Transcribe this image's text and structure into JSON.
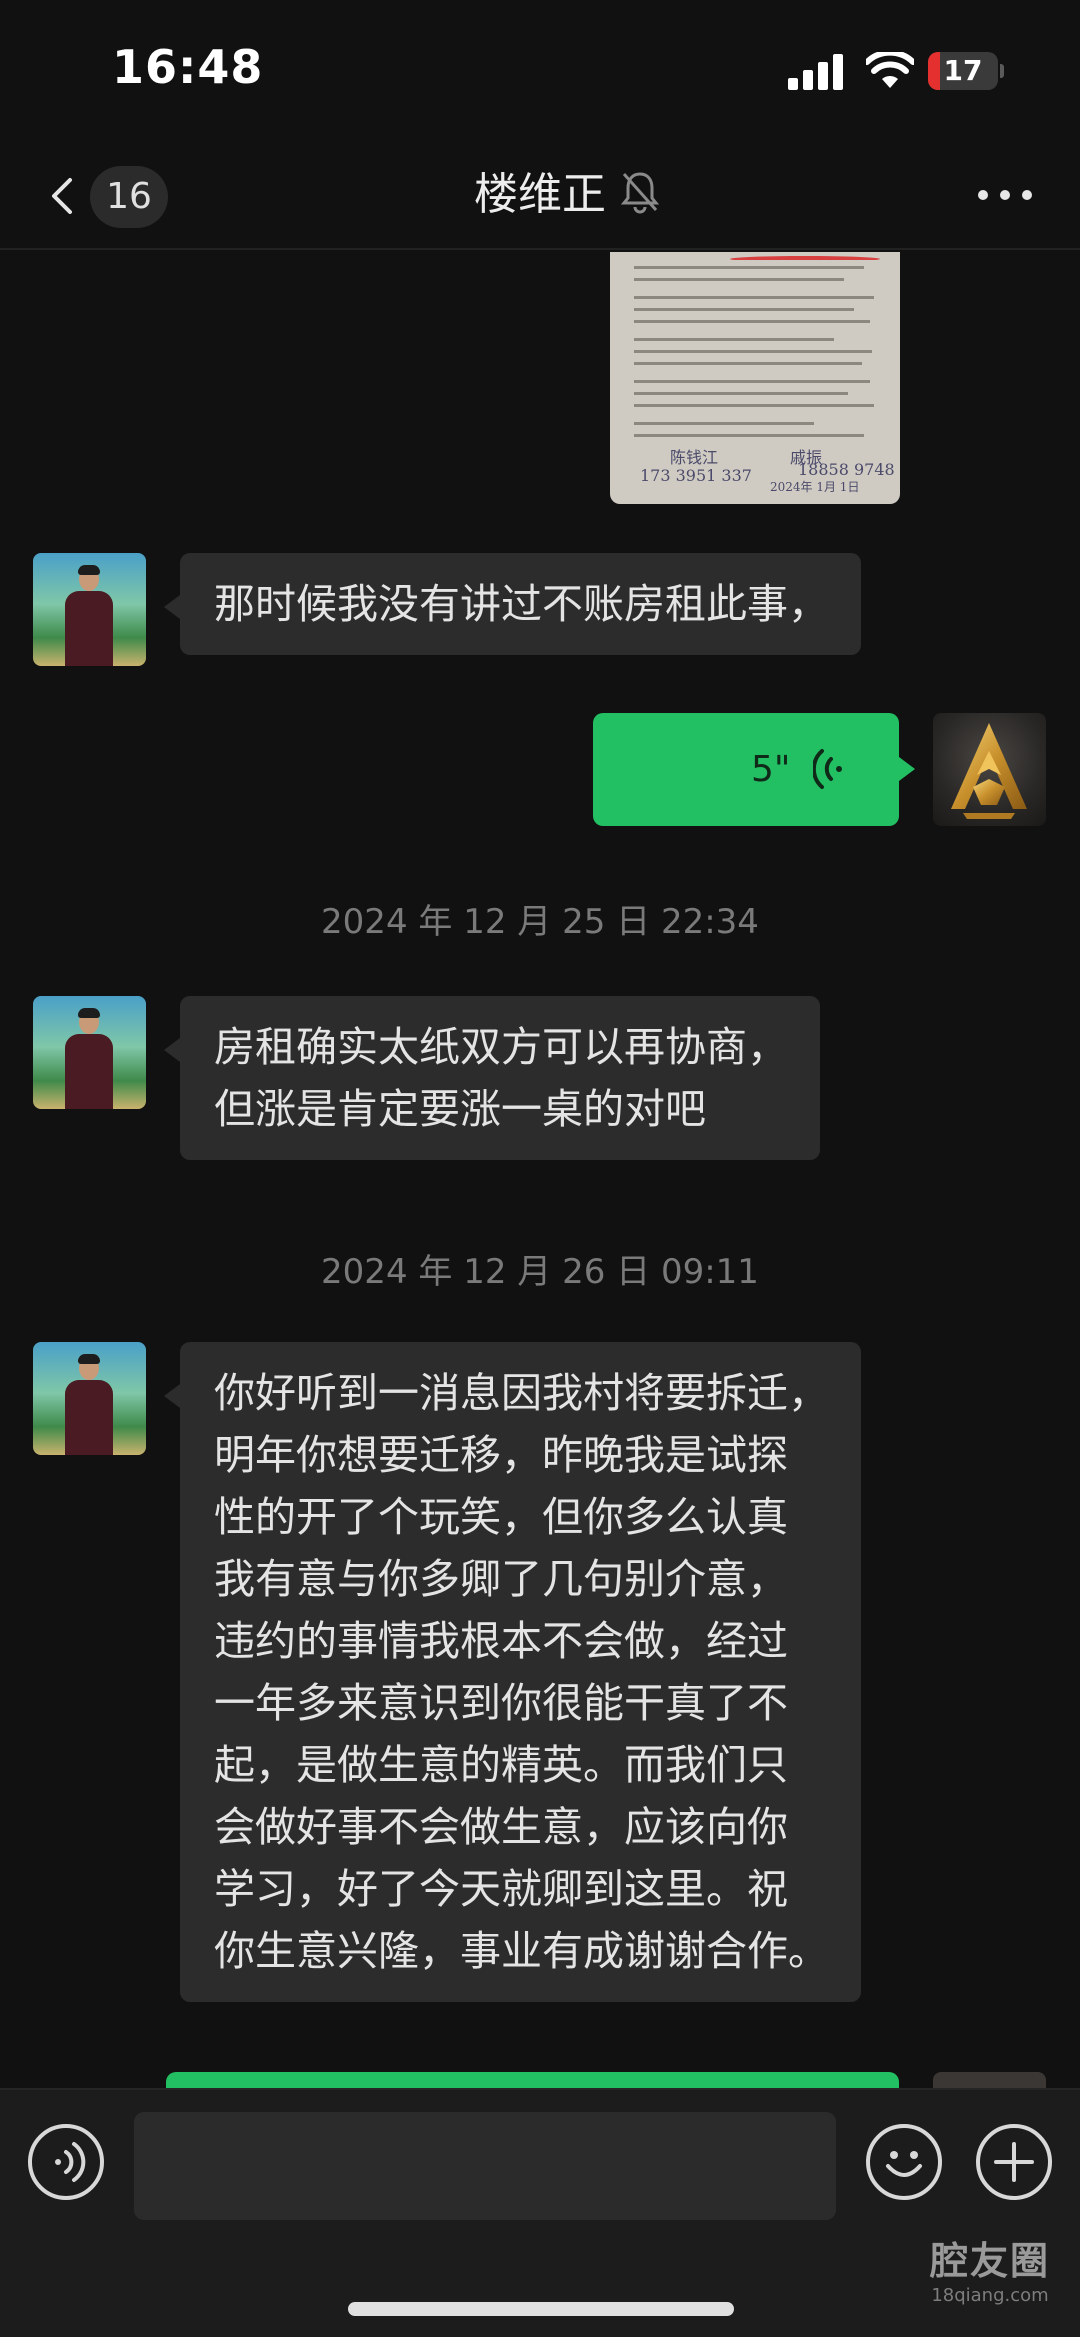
{
  "status_bar": {
    "time": "16:48",
    "battery_level": "17",
    "battery_fraction": 0.17,
    "battery_color": "#e4312f"
  },
  "nav": {
    "back_icon": "chevron-left-icon",
    "unread_count": "16",
    "title": "楼维正",
    "mute_icon": "bell-muted-icon",
    "more_icon": "ellipsis-icon"
  },
  "chat": {
    "messages": [
      {
        "type": "image",
        "side": "left",
        "description_icon": "document-image"
      },
      {
        "type": "text",
        "side": "left",
        "text": "那时候我没有讲过不账房租此事，"
      },
      {
        "type": "voice",
        "side": "right",
        "duration": "5\""
      },
      {
        "type": "timestamp",
        "text": "2024 年 12 月 25 日 22:34"
      },
      {
        "type": "text",
        "side": "left",
        "lines": [
          "房租确实太纸双方可以再协商，",
          "但涨是肯定要涨一桌的对吧"
        ]
      },
      {
        "type": "timestamp",
        "text": "2024 年 12 月 26 日 09:11"
      },
      {
        "type": "text",
        "side": "left",
        "lines": [
          "你好听到一消息因我村将要拆迁，",
          "明年你想要迁移，昨晚我是试探",
          "性的开了个玩笑，但你多么认真",
          "我有意与你多卿了几句别介意，",
          "违约的事情我根本不会做，经过",
          "一年多来意识到你很能干真了不",
          "起，是做生意的精英。而我们只",
          "会做好事不会做生意，应该向你",
          "学习，好了今天就卿到这里。祝",
          "你生意兴隆，事业有成谢谢合作。"
        ]
      }
    ],
    "self_bubble_color": "#23c063",
    "other_bubble_color": "#2c2c2c"
  },
  "document": {
    "sign_left": "陈钱江",
    "phone_left": "173 3951 337",
    "sign_right": "戚振",
    "phone_right": "18858 9748",
    "date": "2024年 1月 1日"
  },
  "input_bar": {
    "voice_icon": "voice-mode-icon",
    "input_value": "",
    "emoji_icon": "emoji-icon",
    "plus_icon": "plus-icon"
  },
  "watermark": {
    "main": "腔友圈",
    "sub": "18qiang.com"
  }
}
